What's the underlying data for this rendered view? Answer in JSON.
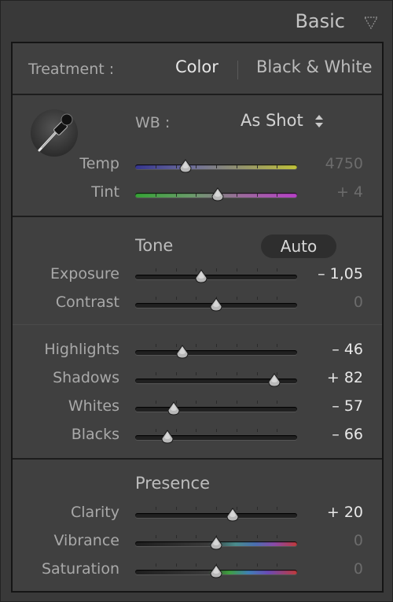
{
  "panel": {
    "title": "Basic"
  },
  "treatment": {
    "label": "Treatment :",
    "color": "Color",
    "bw": "Black & White"
  },
  "wb": {
    "label": "WB :",
    "value": "As Shot",
    "temp": {
      "label": "Temp",
      "value": "4750",
      "level": 0.31
    },
    "tint": {
      "label": "Tint",
      "value": "+ 4",
      "level": 0.51
    }
  },
  "tone": {
    "heading": "Tone",
    "auto": "Auto",
    "exposure": {
      "label": "Exposure",
      "value": "– 1,05",
      "level": 0.41
    },
    "contrast": {
      "label": "Contrast",
      "value": "0",
      "level": 0.5
    },
    "highlights": {
      "label": "Highlights",
      "value": "– 46",
      "level": 0.29
    },
    "shadows": {
      "label": "Shadows",
      "value": "+ 82",
      "level": 0.86
    },
    "whites": {
      "label": "Whites",
      "value": "– 57",
      "level": 0.24
    },
    "blacks": {
      "label": "Blacks",
      "value": "– 66",
      "level": 0.2
    }
  },
  "presence": {
    "heading": "Presence",
    "clarity": {
      "label": "Clarity",
      "value": "+ 20",
      "level": 0.6
    },
    "vibrance": {
      "label": "Vibrance",
      "value": "0",
      "level": 0.5
    },
    "saturation": {
      "label": "Saturation",
      "value": "0",
      "level": 0.5
    }
  }
}
